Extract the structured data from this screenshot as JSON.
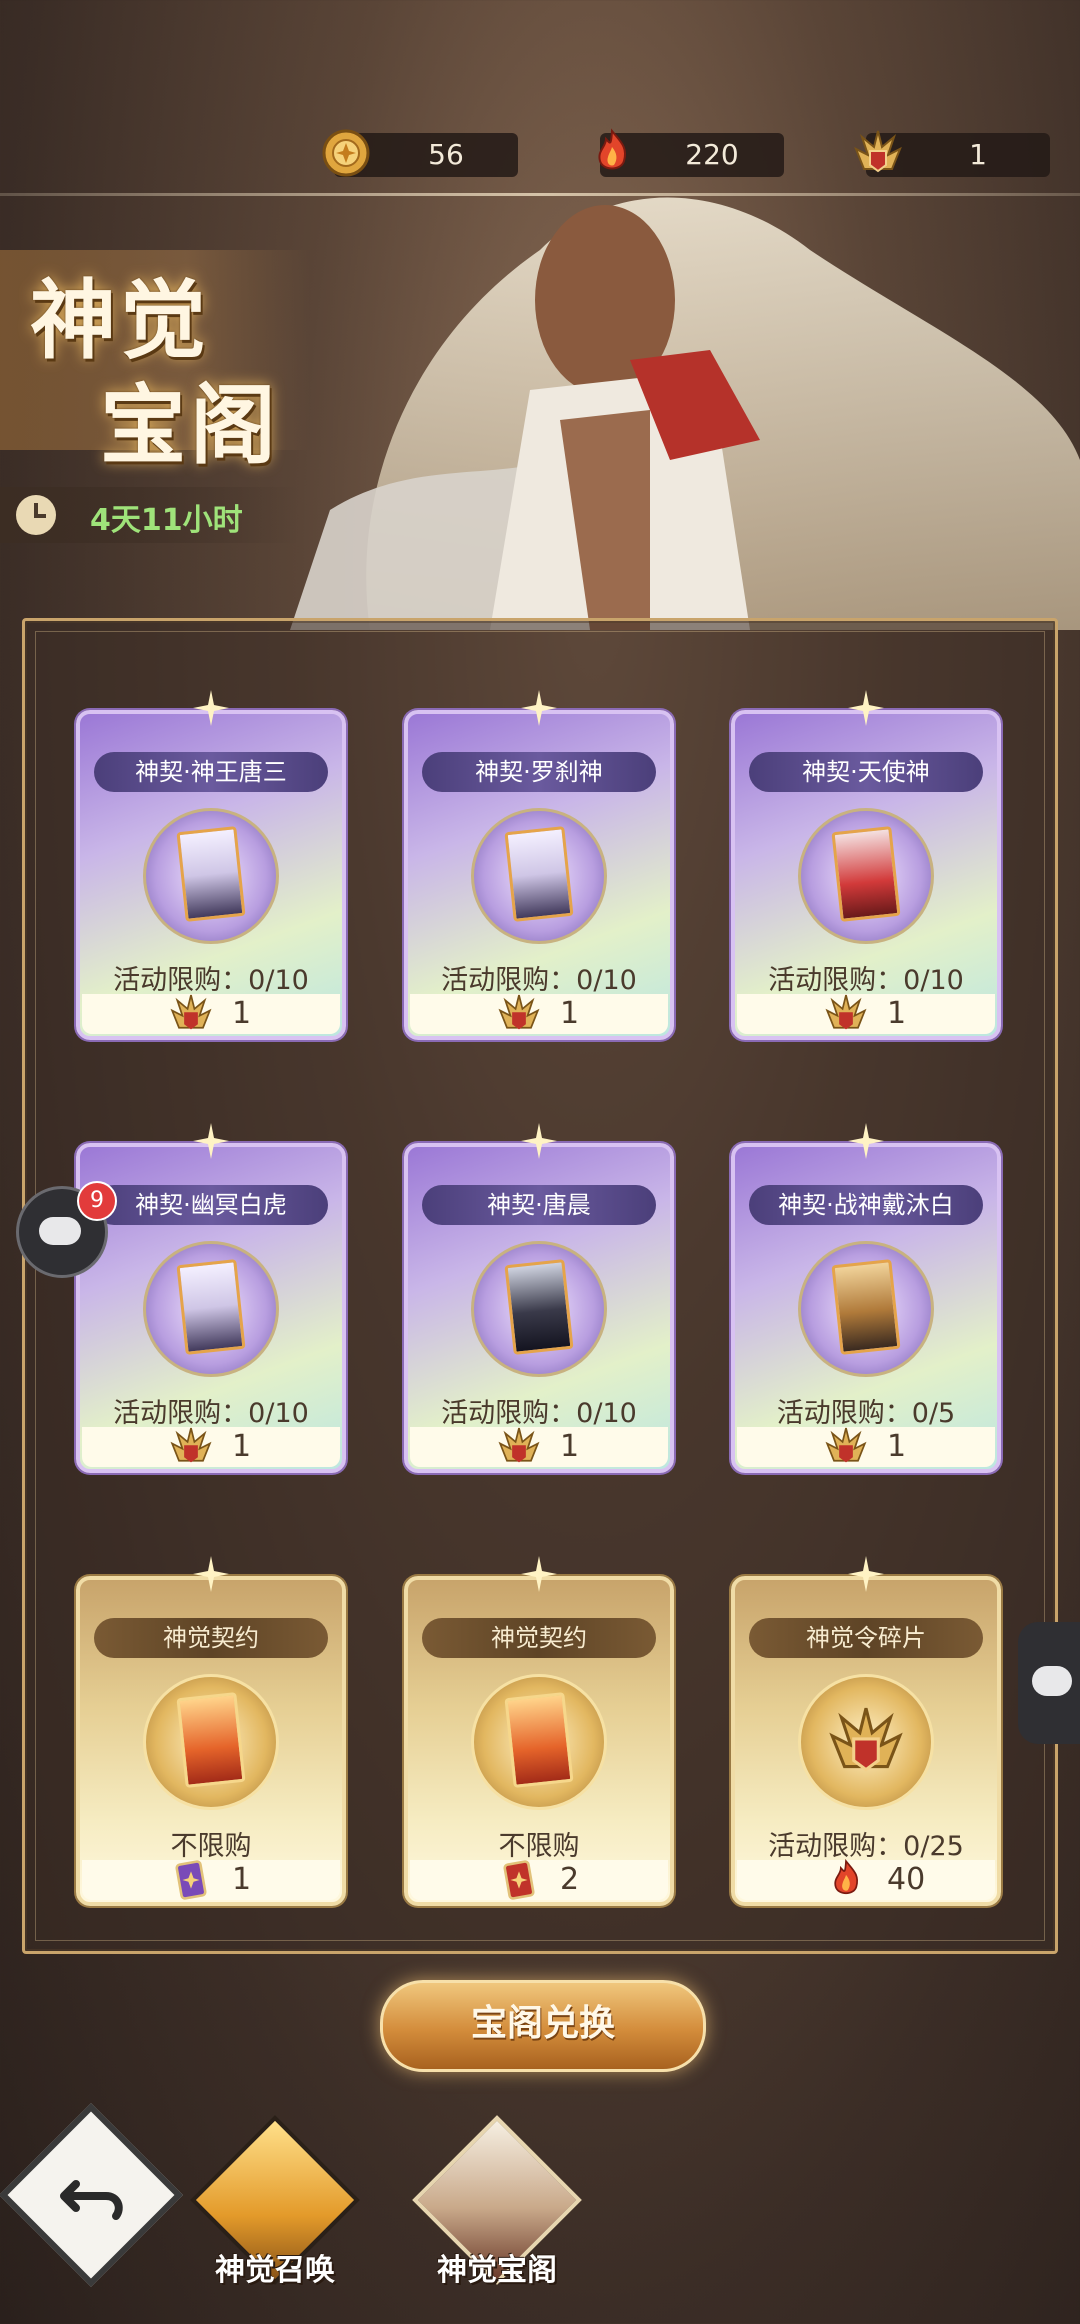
{
  "resources": [
    {
      "icon": "gold-coin-icon",
      "value": "56"
    },
    {
      "icon": "fire-crystal-icon",
      "value": "220"
    },
    {
      "icon": "emblem-token-icon",
      "value": "1"
    }
  ],
  "header": {
    "title_line1": "神觉",
    "title_line2": "宝阁",
    "timer": "4天11小时"
  },
  "cards": [
    {
      "name": "神契·神王唐三",
      "limit": "活动限购：0/10",
      "cost": "1"
    },
    {
      "name": "神契·罗刹神",
      "limit": "活动限购：0/10",
      "cost": "1"
    },
    {
      "name": "神契·天使神",
      "limit": "活动限购：0/10",
      "cost": "1"
    },
    {
      "name": "神契·幽冥白虎",
      "limit": "活动限购：0/10",
      "cost": "1"
    },
    {
      "name": "神契·唐晨",
      "limit": "活动限购：0/10",
      "cost": "1"
    },
    {
      "name": "神契·战神戴沐白",
      "limit": "活动限购：0/5",
      "cost": "1"
    },
    {
      "name": "神觉契约",
      "limit": "不限购",
      "cost": "1"
    },
    {
      "name": "神觉契约",
      "limit": "不限购",
      "cost": "2"
    },
    {
      "name": "神觉令碎片",
      "limit": "活动限购：0/25",
      "cost": "40"
    }
  ],
  "redeem_button": "宝阁兑换",
  "chat_badge": "9",
  "bottom_nav": {
    "summon": "神觉召唤",
    "treasure": "神觉宝阁"
  },
  "colors": {
    "timer_text": "#9fe37a",
    "accent_gold": "#c9a46b"
  }
}
